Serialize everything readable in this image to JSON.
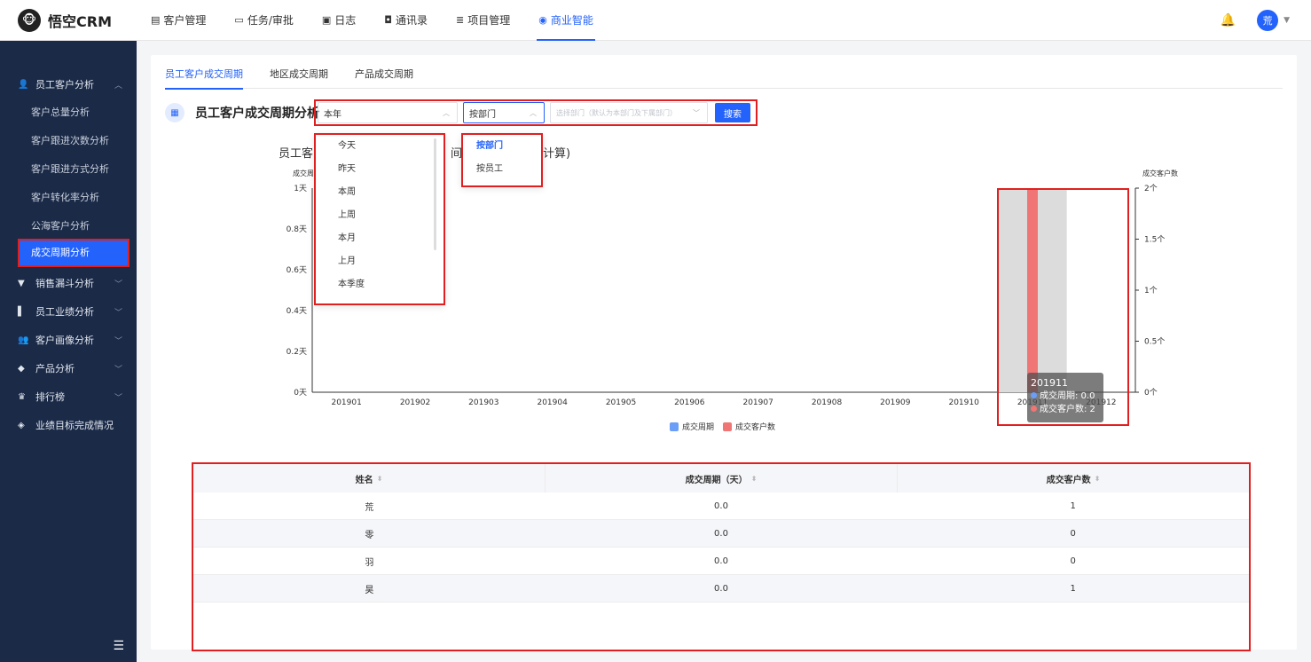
{
  "app": {
    "name": "悟空CRM",
    "logo_char": "🐵"
  },
  "nav": [
    {
      "icon": "▤",
      "label": "客户管理"
    },
    {
      "icon": "▭",
      "label": "任务/审批"
    },
    {
      "icon": "▣",
      "label": "日志"
    },
    {
      "icon": "◘",
      "label": "通讯录"
    },
    {
      "icon": "≣",
      "label": "项目管理"
    },
    {
      "icon": "◉",
      "label": "商业智能"
    }
  ],
  "user": {
    "avatar": "荒"
  },
  "sidebar": {
    "group1": {
      "label": "员工客户分析"
    },
    "subitems": [
      "客户总量分析",
      "客户跟进次数分析",
      "客户跟进方式分析",
      "客户转化率分析",
      "公海客户分析",
      "成交周期分析"
    ],
    "groups": [
      {
        "label": "销售漏斗分析"
      },
      {
        "label": "员工业绩分析"
      },
      {
        "label": "客户画像分析"
      },
      {
        "label": "产品分析"
      },
      {
        "label": "排行榜"
      },
      {
        "label": "业绩目标完成情况"
      }
    ],
    "toggle": "☰"
  },
  "tabs": [
    "员工客户成交周期",
    "地区成交周期",
    "产品成交周期"
  ],
  "page_title": "员工客户成交周期分析",
  "filters": {
    "period": "本年",
    "mode": "按部门",
    "dept_placeholder": "选择部门（默认为本部门及下属部门）",
    "search": "搜索"
  },
  "period_options": [
    "今天",
    "昨天",
    "本周",
    "上周",
    "本月",
    "上月",
    "本季度"
  ],
  "mode_options": [
    "按部门",
    "按员工"
  ],
  "chart_title_parts": [
    "员工客",
    "间",
    "计算)"
  ],
  "chart_data": {
    "type": "bar",
    "categories": [
      "201901",
      "201902",
      "201903",
      "201904",
      "201905",
      "201906",
      "201907",
      "201908",
      "201909",
      "201910",
      "201911",
      "201912"
    ],
    "series": [
      {
        "name": "成交周期",
        "values": [
          0,
          0,
          0,
          0,
          0,
          0,
          0,
          0,
          0,
          0,
          0.0,
          0
        ]
      },
      {
        "name": "成交客户数",
        "values": [
          0,
          0,
          0,
          0,
          0,
          0,
          0,
          0,
          0,
          0,
          2,
          0
        ]
      }
    ],
    "ylabel_left": "成交周",
    "ylabel_right": "成交客户数",
    "y_left_ticks": [
      "0天",
      "0.2天",
      "0.4天",
      "0.6天",
      "0.8天",
      "1天"
    ],
    "y_right_ticks": [
      "0个",
      "0.5个",
      "1个",
      "1.5个",
      "2个"
    ],
    "ylim_left": [
      0,
      1
    ],
    "ylim_right": [
      0,
      2
    ],
    "colors": {
      "成交周期": "#6a9ef7",
      "成交客户数": "#f07575"
    }
  },
  "tooltip": {
    "title": "201911",
    "line1": "成交周期: 0.0",
    "line2": "成交客户数: 2"
  },
  "table": {
    "headers": [
      "姓名",
      "成交周期（天）",
      "成交客户数"
    ],
    "rows": [
      [
        "荒",
        "0.0",
        "1"
      ],
      [
        "零",
        "0.0",
        "0"
      ],
      [
        "羽",
        "0.0",
        "0"
      ],
      [
        "昊",
        "0.0",
        "1"
      ]
    ]
  }
}
